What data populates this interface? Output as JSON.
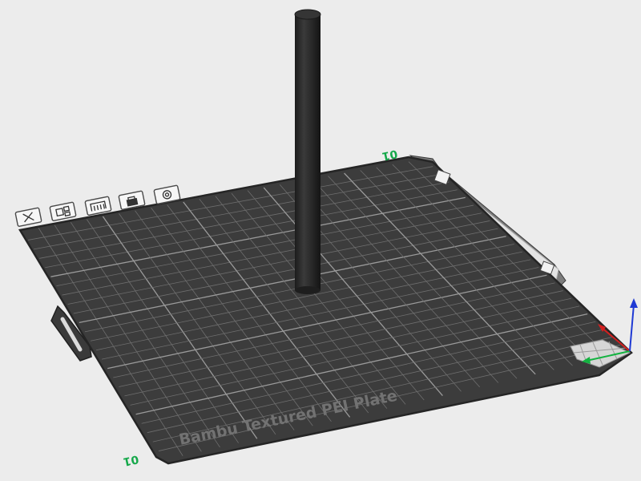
{
  "app": {
    "view": "3D Prepare View"
  },
  "plate": {
    "name": "Bambu Textured PEI Plate",
    "index_front": "01",
    "index_back": "01",
    "colors": {
      "surface": "#3c3c3c",
      "grid_minor": "#6e6e6e",
      "grid_major": "#9a9a9a",
      "border": "#252525"
    }
  },
  "toolbar": {
    "items": [
      {
        "name": "delete-plate-button",
        "icon": "x-icon"
      },
      {
        "name": "arrange-plate-button",
        "icon": "arrange-icon"
      },
      {
        "name": "orient-plate-button",
        "icon": "orient-icon"
      },
      {
        "name": "lock-plate-button",
        "icon": "lock-icon"
      },
      {
        "name": "plate-settings-button",
        "icon": "settings-icon"
      }
    ]
  },
  "object": {
    "type": "cylinder",
    "color": "#2b2b2b"
  },
  "axes": {
    "x_color": "#d41f1f",
    "y_color": "#14b341",
    "z_color": "#1f3ad4"
  }
}
